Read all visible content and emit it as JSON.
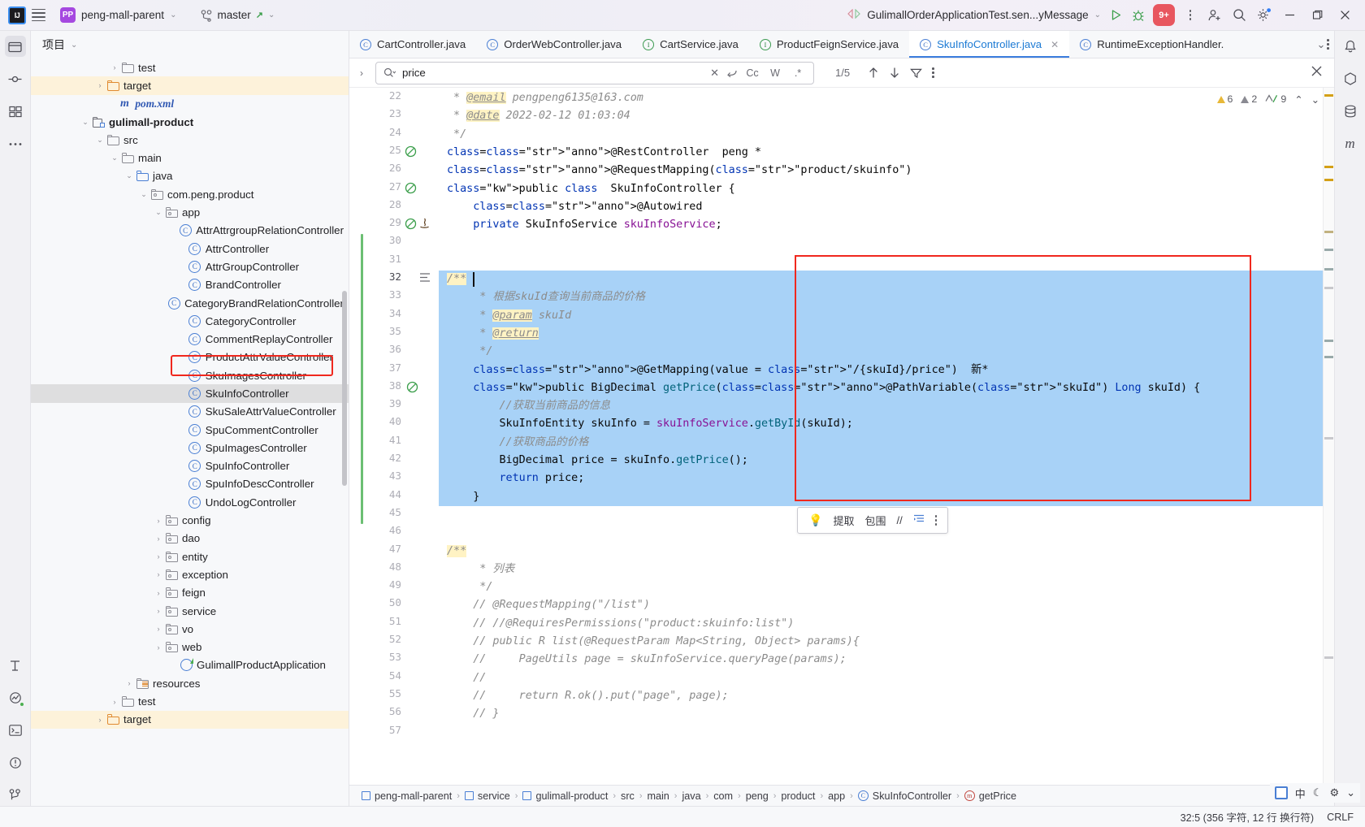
{
  "titlebar": {
    "logo": "IJ",
    "project_name": "peng-mall-parent",
    "project_badge": "PP",
    "branch": "master",
    "run_config": "GulimallOrderApplicationTest.sen...yMessage",
    "services_badge": "9+",
    "icons": [
      "burger-icon",
      "vcs-branch-icon",
      "run-icon",
      "debug-icon",
      "services-icon",
      "more-icon",
      "add-user-icon",
      "search-icon",
      "settings-icon",
      "minimize-icon",
      "maximize-icon",
      "close-icon"
    ]
  },
  "project_panel": {
    "title": "项目",
    "tree": [
      {
        "indent": 5,
        "arrow": "right",
        "icon": "folder",
        "label": "test",
        "state": "normal"
      },
      {
        "indent": 4,
        "arrow": "right",
        "icon": "folder-orange",
        "label": "target",
        "state": "highlight"
      },
      {
        "indent": 4.8,
        "arrow": "none",
        "icon": "maven",
        "label": "pom.xml",
        "state": "normal"
      },
      {
        "indent": 3,
        "arrow": "down",
        "icon": "module",
        "label": "gulimall-product",
        "state": "bold"
      },
      {
        "indent": 4,
        "arrow": "down",
        "icon": "folder",
        "label": "src",
        "state": "normal"
      },
      {
        "indent": 5,
        "arrow": "down",
        "icon": "folder",
        "label": "main",
        "state": "normal"
      },
      {
        "indent": 6,
        "arrow": "down",
        "icon": "folder-blue",
        "label": "java",
        "state": "normal"
      },
      {
        "indent": 7,
        "arrow": "down",
        "icon": "package",
        "label": "com.peng.product",
        "state": "normal"
      },
      {
        "indent": 8,
        "arrow": "down",
        "icon": "package",
        "label": "app",
        "state": "normal"
      },
      {
        "indent": 9.6,
        "arrow": "none",
        "icon": "class",
        "label": "AttrAttrgroupRelationController",
        "state": "normal"
      },
      {
        "indent": 9.6,
        "arrow": "none",
        "icon": "class",
        "label": "AttrController",
        "state": "normal"
      },
      {
        "indent": 9.6,
        "arrow": "none",
        "icon": "class",
        "label": "AttrGroupController",
        "state": "normal"
      },
      {
        "indent": 9.6,
        "arrow": "none",
        "icon": "class",
        "label": "BrandController",
        "state": "normal"
      },
      {
        "indent": 9.6,
        "arrow": "none",
        "icon": "class",
        "label": "CategoryBrandRelationController",
        "state": "normal"
      },
      {
        "indent": 9.6,
        "arrow": "none",
        "icon": "class",
        "label": "CategoryController",
        "state": "normal"
      },
      {
        "indent": 9.6,
        "arrow": "none",
        "icon": "class",
        "label": "CommentReplayController",
        "state": "normal"
      },
      {
        "indent": 9.6,
        "arrow": "none",
        "icon": "class",
        "label": "ProductAttrValueController",
        "state": "normal"
      },
      {
        "indent": 9.6,
        "arrow": "none",
        "icon": "class",
        "label": "SkuImagesController",
        "state": "normal"
      },
      {
        "indent": 9.6,
        "arrow": "none",
        "icon": "class",
        "label": "SkuInfoController",
        "state": "selected"
      },
      {
        "indent": 9.6,
        "arrow": "none",
        "icon": "class",
        "label": "SkuSaleAttrValueController",
        "state": "normal"
      },
      {
        "indent": 9.6,
        "arrow": "none",
        "icon": "class",
        "label": "SpuCommentController",
        "state": "normal"
      },
      {
        "indent": 9.6,
        "arrow": "none",
        "icon": "class",
        "label": "SpuImagesController",
        "state": "normal"
      },
      {
        "indent": 9.6,
        "arrow": "none",
        "icon": "class",
        "label": "SpuInfoController",
        "state": "normal"
      },
      {
        "indent": 9.6,
        "arrow": "none",
        "icon": "class",
        "label": "SpuInfoDescController",
        "state": "normal"
      },
      {
        "indent": 9.6,
        "arrow": "none",
        "icon": "class",
        "label": "UndoLogController",
        "state": "normal"
      },
      {
        "indent": 8,
        "arrow": "right",
        "icon": "package",
        "label": "config",
        "state": "normal"
      },
      {
        "indent": 8,
        "arrow": "right",
        "icon": "package",
        "label": "dao",
        "state": "normal"
      },
      {
        "indent": 8,
        "arrow": "right",
        "icon": "package",
        "label": "entity",
        "state": "normal"
      },
      {
        "indent": 8,
        "arrow": "right",
        "icon": "package",
        "label": "exception",
        "state": "normal"
      },
      {
        "indent": 8,
        "arrow": "right",
        "icon": "package",
        "label": "feign",
        "state": "normal"
      },
      {
        "indent": 8,
        "arrow": "right",
        "icon": "package",
        "label": "service",
        "state": "normal"
      },
      {
        "indent": 8,
        "arrow": "right",
        "icon": "package",
        "label": "vo",
        "state": "normal"
      },
      {
        "indent": 8,
        "arrow": "right",
        "icon": "package",
        "label": "web",
        "state": "normal"
      },
      {
        "indent": 9,
        "arrow": "none",
        "icon": "spring",
        "label": "GulimallProductApplication",
        "state": "normal"
      },
      {
        "indent": 6,
        "arrow": "right",
        "icon": "resources",
        "label": "resources",
        "state": "normal"
      },
      {
        "indent": 5,
        "arrow": "right",
        "icon": "folder",
        "label": "test",
        "state": "normal"
      },
      {
        "indent": 4,
        "arrow": "right",
        "icon": "folder-orange",
        "label": "target",
        "state": "highlight"
      }
    ]
  },
  "editor_tabs": [
    {
      "label": "CartController.java",
      "icon": "class-icon",
      "kind": "class",
      "active": false,
      "closable": false
    },
    {
      "label": "OrderWebController.java",
      "icon": "class-icon",
      "kind": "class",
      "active": false,
      "closable": false
    },
    {
      "label": "CartService.java",
      "icon": "interface-icon",
      "kind": "interface",
      "active": false,
      "closable": false
    },
    {
      "label": "ProductFeignService.java",
      "icon": "interface-icon",
      "kind": "interface",
      "active": false,
      "closable": false
    },
    {
      "label": "SkuInfoController.java",
      "icon": "class-icon",
      "kind": "class",
      "active": true,
      "closable": true
    },
    {
      "label": "RuntimeExceptionHandler.",
      "icon": "class-icon",
      "kind": "class",
      "active": false,
      "closable": false
    }
  ],
  "find_bar": {
    "query": "price",
    "placeholder": "",
    "count": "1/5",
    "toggles": [
      "Cc",
      "W",
      ".*"
    ],
    "icons": [
      "search-dropdown-icon",
      "clear-icon",
      "preserve-case-icon",
      "prev-match-icon",
      "next-match-icon",
      "filter-icon",
      "more-options-icon",
      "close-find-icon"
    ]
  },
  "inspections": {
    "warnings": "6",
    "weak_warnings": "2",
    "typos": "9"
  },
  "intention_popup": {
    "items": [
      "提取",
      "包围",
      "//",
      "缩进"
    ],
    "icons": [
      "bulb-icon",
      "extract-icon",
      "surround-icon",
      "comment-icon",
      "indent-icon",
      "more-icon"
    ]
  },
  "code": {
    "first_line": 22,
    "lines": [
      {
        "n": 22,
        "text": " * @email pengpeng6135@163.com"
      },
      {
        "n": 23,
        "text": " * @date 2022-02-12 01:03:04"
      },
      {
        "n": 24,
        "text": " */"
      },
      {
        "n": 25,
        "text": "@RestController  peng *"
      },
      {
        "n": 26,
        "text": "@RequestMapping(\"product/skuinfo\")"
      },
      {
        "n": 27,
        "text": "public class  SkuInfoController {"
      },
      {
        "n": 28,
        "text": "    @Autowired"
      },
      {
        "n": 29,
        "text": "    private SkuInfoService skuInfoService;"
      },
      {
        "n": 30,
        "text": ""
      },
      {
        "n": 31,
        "text": ""
      },
      {
        "n": 32,
        "text": "    /**"
      },
      {
        "n": 33,
        "text": "     * 根据skuId查询当前商品的价格"
      },
      {
        "n": 34,
        "text": "     * @param skuId"
      },
      {
        "n": 35,
        "text": "     * @return"
      },
      {
        "n": 36,
        "text": "     */"
      },
      {
        "n": 37,
        "text": "    @GetMapping(value = \"/{skuId}/price\")  新*"
      },
      {
        "n": 38,
        "text": "    public BigDecimal getPrice(@PathVariable(\"skuId\") Long skuId) {"
      },
      {
        "n": 39,
        "text": "        //获取当前商品的信息"
      },
      {
        "n": 40,
        "text": "        SkuInfoEntity skuInfo = skuInfoService.getById(skuId);"
      },
      {
        "n": 41,
        "text": "        //获取商品的价格"
      },
      {
        "n": 42,
        "text": "        BigDecimal price = skuInfo.getPrice();"
      },
      {
        "n": 43,
        "text": "        return price;"
      },
      {
        "n": 44,
        "text": "    }"
      },
      {
        "n": 45,
        "text": ""
      },
      {
        "n": 46,
        "text": ""
      },
      {
        "n": 47,
        "text": "    /**"
      },
      {
        "n": 48,
        "text": "     * 列表"
      },
      {
        "n": 49,
        "text": "     */"
      },
      {
        "n": 50,
        "text": "    // @RequestMapping(\"/list\")"
      },
      {
        "n": 51,
        "text": "    // //@RequiresPermissions(\"product:skuinfo:list\")"
      },
      {
        "n": 52,
        "text": "    // public R list(@RequestParam Map<String, Object> params){"
      },
      {
        "n": 53,
        "text": "    //     PageUtils page = skuInfoService.queryPage(params);"
      },
      {
        "n": 54,
        "text": "    //"
      },
      {
        "n": 55,
        "text": "    //     return R.ok().put(\"page\", page);"
      },
      {
        "n": 56,
        "text": "    // }"
      },
      {
        "n": 57,
        "text": ""
      }
    ]
  },
  "breadcrumbs": [
    {
      "label": "peng-mall-parent",
      "icon": "module-icon"
    },
    {
      "label": "service",
      "icon": "module-icon"
    },
    {
      "label": "gulimall-product",
      "icon": "module-icon"
    },
    {
      "label": "src",
      "icon": "none"
    },
    {
      "label": "main",
      "icon": "none"
    },
    {
      "label": "java",
      "icon": "none"
    },
    {
      "label": "com",
      "icon": "none"
    },
    {
      "label": "peng",
      "icon": "none"
    },
    {
      "label": "product",
      "icon": "none"
    },
    {
      "label": "app",
      "icon": "none"
    },
    {
      "label": "SkuInfoController",
      "icon": "class-icon"
    },
    {
      "label": "getPrice",
      "icon": "method-icon"
    }
  ],
  "status_bar": {
    "caret": "32:5 (356 字符, 12 行 换行符)",
    "line_separator": "CRLF",
    "ime_lang": "中"
  }
}
